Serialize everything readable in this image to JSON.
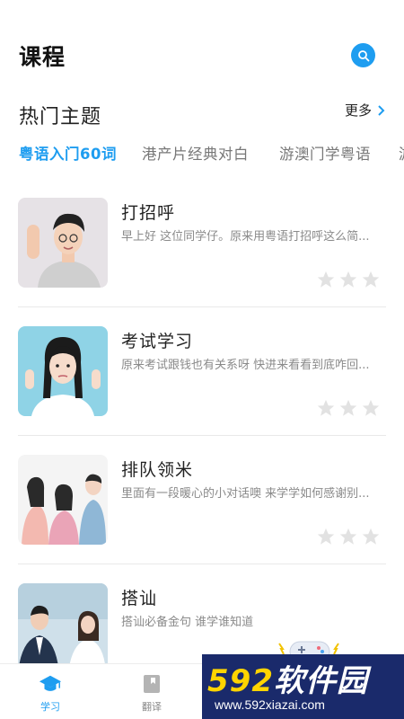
{
  "header": {
    "title": "课程"
  },
  "section": {
    "title": "热门主题",
    "more_label": "更多"
  },
  "tabs": [
    {
      "label": "粤语入门60词",
      "active": true
    },
    {
      "label": "港产片经典对白",
      "active": false
    },
    {
      "label": "游澳门学粤语",
      "active": false
    },
    {
      "label": "游",
      "active": false
    }
  ],
  "courses": [
    {
      "title": "打招呼",
      "desc": "早上好 这位同学仔。原来用粤语打招呼这么简...",
      "stars": 0
    },
    {
      "title": "考试学习",
      "desc": "原来考试跟钱也有关系呀 快进来看看到底咋回...",
      "stars": 0
    },
    {
      "title": "排队领米",
      "desc": "里面有一段暖心的小对话噢 来学学如何感谢别...",
      "stars": 0
    },
    {
      "title": "搭讪",
      "desc": "搭讪必备金句 谁学谁知道",
      "stars": 0
    }
  ],
  "tabbar": [
    {
      "label": "学习",
      "icon": "graduation-cap-icon",
      "active": true
    },
    {
      "label": "翻译",
      "icon": "book-icon",
      "active": false
    }
  ],
  "watermark": {
    "brand_num": "592",
    "brand_text": "软件园",
    "url": "www.592xiazai.com"
  },
  "colors": {
    "accent": "#1e9df0",
    "star_empty": "#e2e2e2",
    "text_muted": "#8a8a8a"
  }
}
